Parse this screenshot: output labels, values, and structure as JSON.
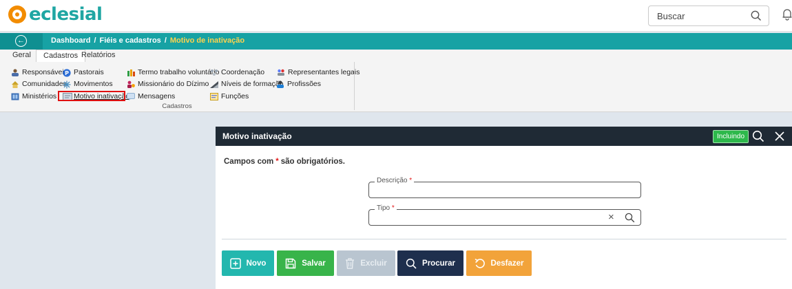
{
  "app": {
    "logo_text": "eclesial",
    "search_placeholder": "Buscar"
  },
  "breadcrumb": {
    "items": [
      "Dashboard",
      "Fiéis e cadastros",
      "Motivo de inativação"
    ],
    "separator": "/"
  },
  "tabs": [
    {
      "label": "Geral"
    },
    {
      "label": "Cadastros",
      "active": true
    },
    {
      "label": "Relatórios"
    }
  ],
  "ribbon": {
    "group_label": "Cadastros",
    "items": [
      "Responsáveis",
      "Pastorais",
      "Termo trabalho voluntário",
      "Coordenação",
      "Representantes legais",
      "Comunidades",
      "Movimentos",
      "Missionário do Dízimo",
      "Níveis de formação",
      "Profissões",
      "Ministérios",
      "Motivo inativação",
      "Mensagens",
      "Funções"
    ],
    "highlighted": "Motivo inativação"
  },
  "modal": {
    "title": "Motivo inativação",
    "status_badge": "Incluindo",
    "required_note_prefix": "Campos com",
    "required_star": "*",
    "required_note_suffix": "são obrigatórios.",
    "fields": [
      {
        "label": "Descrição",
        "required": true,
        "value": ""
      },
      {
        "label": "Tipo",
        "required": true,
        "value": "",
        "clear_icon": "×"
      }
    ],
    "buttons": [
      {
        "label": "Novo",
        "icon": "plus-box-icon",
        "color": "#23b7ae",
        "enabled": true
      },
      {
        "label": "Salvar",
        "icon": "save-icon",
        "color": "#38b44a",
        "enabled": true
      },
      {
        "label": "Excluir",
        "icon": "trash-icon",
        "color": "#b9c5d0",
        "enabled": false
      },
      {
        "label": "Procurar",
        "icon": "search-icon",
        "color": "#1e2f4d",
        "enabled": true
      },
      {
        "label": "Desfazer",
        "icon": "undo-icon",
        "color": "#f2a33a",
        "enabled": true
      }
    ]
  },
  "colors": {
    "brand_teal": "#17a2a4",
    "brand_orange": "#f28c00",
    "modal_header": "#1f2a35",
    "breadcrumb_current": "#ffd34d",
    "required": "#e21b1b"
  }
}
